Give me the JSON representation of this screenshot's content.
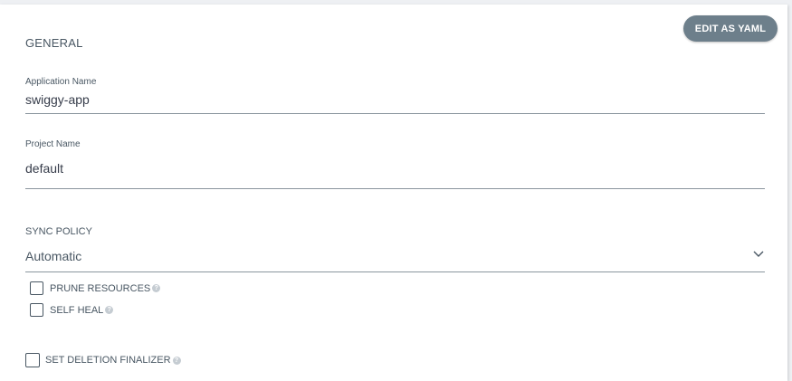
{
  "general": {
    "section_title": "GENERAL",
    "edit_yaml_label": "EDIT AS YAML"
  },
  "application_name": {
    "label": "Application Name",
    "value": "swiggy-app"
  },
  "project_name": {
    "label": "Project Name",
    "value": "default"
  },
  "sync_policy": {
    "label": "SYNC POLICY",
    "selected": "Automatic",
    "options": {
      "prune_resources": {
        "label": "PRUNE RESOURCES",
        "checked": false
      },
      "self_heal": {
        "label": "SELF HEAL",
        "checked": false
      }
    }
  },
  "deletion_finalizer": {
    "label": "SET DELETION FINALIZER",
    "checked": false
  },
  "icons": {
    "help": "help-circle-icon",
    "dropdown": "chevron-down-icon"
  },
  "colors": {
    "button_bg": "#6d7f8b",
    "text": "#495763",
    "border": "#8a959e"
  }
}
